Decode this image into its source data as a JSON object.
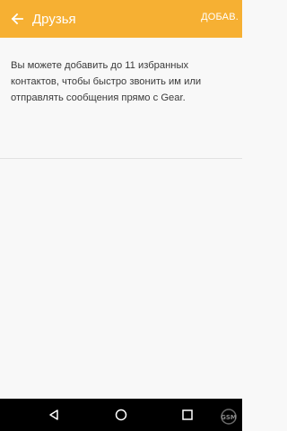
{
  "appbar": {
    "title": "Друзья",
    "add_label": "ДОБАВ.",
    "back_icon": "arrow-left-icon",
    "background_color": "#f6b033"
  },
  "content": {
    "description": "Вы можете добавить до 11 избранных\nконтактов, чтобы быстро звонить им или\nотправлять сообщения прямо с Gear."
  },
  "navbar": {
    "back_icon": "triangle-back-icon",
    "home_icon": "circle-home-icon",
    "recents_icon": "square-recents-icon"
  },
  "watermark": {
    "text": "GSM"
  }
}
